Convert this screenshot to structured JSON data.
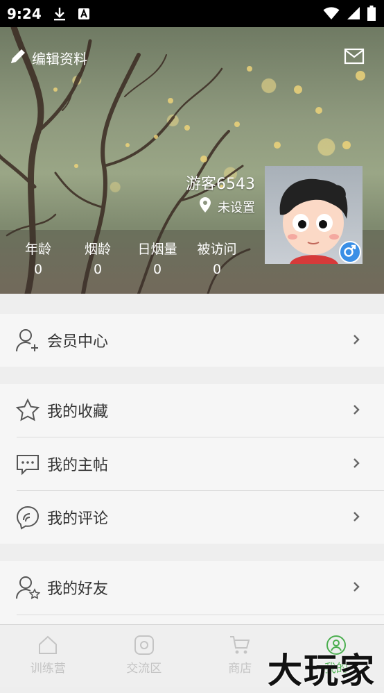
{
  "status_bar": {
    "time": "9:24",
    "icons": [
      "download-icon",
      "a-badge-icon",
      "wifi-icon",
      "signal-icon",
      "battery-icon"
    ]
  },
  "header": {
    "edit_label": "编辑资料",
    "mail_icon": "mail-icon"
  },
  "profile": {
    "username": "游客6543",
    "location": "未设置",
    "gender_symbol": "♂",
    "gender_color": "#3a8fe6"
  },
  "stats": [
    {
      "label": "年龄",
      "value": "0"
    },
    {
      "label": "烟龄",
      "value": "0"
    },
    {
      "label": "日烟量",
      "value": "0"
    },
    {
      "label": "被访问",
      "value": "0"
    }
  ],
  "menu": {
    "group1": [
      {
        "label": "会员中心",
        "icon": "member-add-icon"
      }
    ],
    "group2": [
      {
        "label": "我的收藏",
        "icon": "star-icon"
      },
      {
        "label": "我的主帖",
        "icon": "message-dots-icon"
      },
      {
        "label": "我的评论",
        "icon": "comment-icon"
      }
    ],
    "group3": [
      {
        "label": "我的好友",
        "icon": "friend-star-icon"
      }
    ]
  },
  "tabs": [
    {
      "label": "训练营",
      "icon": "home-icon",
      "active": false
    },
    {
      "label": "交流区",
      "icon": "community-icon",
      "active": false
    },
    {
      "label": "商店",
      "icon": "cart-icon",
      "active": false
    },
    {
      "label": "我的",
      "icon": "profile-icon",
      "active": true
    }
  ],
  "watermark": "大玩家",
  "accent_color": "#4caf50"
}
